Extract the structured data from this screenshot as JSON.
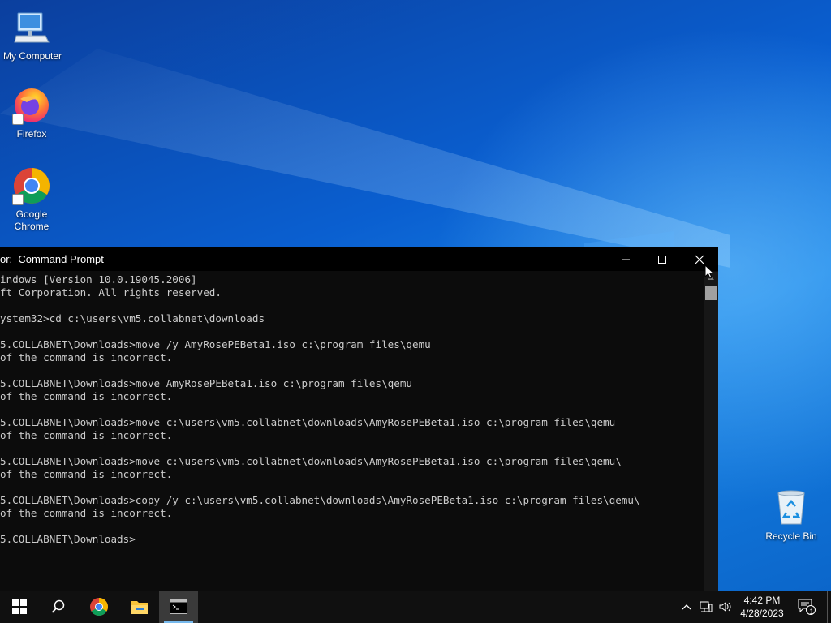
{
  "desktop": {
    "icons": [
      {
        "label": "My Computer",
        "icon": "computer-icon"
      },
      {
        "label": "Firefox",
        "icon": "firefox-icon"
      },
      {
        "label": "Google Chrome",
        "icon": "chrome-icon"
      },
      {
        "label": "Recycle Bin",
        "icon": "recycle-bin-icon"
      }
    ]
  },
  "cmd": {
    "title": "or:  Command Prompt",
    "lines": [
      "indows [Version 10.0.19045.2006]",
      "ft Corporation. All rights reserved.",
      "",
      "ystem32>cd c:\\users\\vm5.collabnet\\downloads",
      "",
      "5.COLLABNET\\Downloads>move /y AmyRosePEBeta1.iso c:\\program files\\qemu",
      "of the command is incorrect.",
      "",
      "5.COLLABNET\\Downloads>move AmyRosePEBeta1.iso c:\\program files\\qemu",
      "of the command is incorrect.",
      "",
      "5.COLLABNET\\Downloads>move c:\\users\\vm5.collabnet\\downloads\\AmyRosePEBeta1.iso c:\\program files\\qemu",
      "of the command is incorrect.",
      "",
      "5.COLLABNET\\Downloads>move c:\\users\\vm5.collabnet\\downloads\\AmyRosePEBeta1.iso c:\\program files\\qemu\\",
      "of the command is incorrect.",
      "",
      "5.COLLABNET\\Downloads>copy /y c:\\users\\vm5.collabnet\\downloads\\AmyRosePEBeta1.iso c:\\program files\\qemu\\",
      "of the command is incorrect.",
      "",
      "5.COLLABNET\\Downloads>"
    ]
  },
  "taskbar": {
    "time": "4:42 PM",
    "date": "4/28/2023",
    "notification_count": "1"
  },
  "colors": {
    "cmd_background": "#0c0c0c",
    "cmd_text": "#cccccc",
    "taskbar": "#101010",
    "accent": "#76b9ed"
  }
}
